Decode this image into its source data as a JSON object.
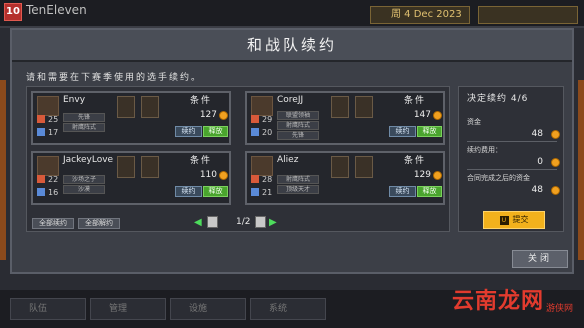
{
  "app": {
    "team_name": "TenEleven",
    "logo_text": "10",
    "date": "周 4 Dec 2023"
  },
  "dialog": {
    "title": "和战队续约",
    "instruction": "请和需要在下赛季使用的选手续约。",
    "close_label": "关闭"
  },
  "players": [
    {
      "name": "Envy",
      "stat_attack": "25",
      "stat_defense": "17",
      "traits": [
        "先锋",
        "射鹰阵式"
      ],
      "condition_label": "条件",
      "salary": "127",
      "renew_label": "续约",
      "release_label": "释放"
    },
    {
      "name": "CoreJJ",
      "stat_attack": "29",
      "stat_defense": "20",
      "traits": [
        "联盟领袖",
        "射鹰阵式",
        "先锋"
      ],
      "condition_label": "条件",
      "salary": "147",
      "renew_label": "续约",
      "release_label": "释放"
    },
    {
      "name": "JackeyLove",
      "stat_attack": "22",
      "stat_defense": "16",
      "traits": [
        "沙场之子",
        "沙漠"
      ],
      "condition_label": "条件",
      "salary": "110",
      "renew_label": "续约",
      "release_label": "释放"
    },
    {
      "name": "Aliez",
      "stat_attack": "28",
      "stat_defense": "21",
      "traits": [
        "射鹰阵式",
        "顶级天才"
      ],
      "condition_label": "条件",
      "salary": "129",
      "renew_label": "续约",
      "release_label": "释放"
    }
  ],
  "pagination": {
    "renew_all": "全部续约",
    "release_all": "全部解约",
    "page": "1/2"
  },
  "summary": {
    "heading": "决定续约 4/6",
    "funds_label": "资金",
    "funds_value": "48",
    "cost_label": "续约费用：",
    "cost_value": "0",
    "after_label": "合同完成之后的资金",
    "after_value": "48",
    "submit_key": "U",
    "submit_label": "提交"
  },
  "bottom_tabs": [
    "队伍",
    "管理",
    "设施",
    "系统"
  ],
  "watermark": {
    "main": "云南龙网",
    "sub": "游侠网"
  },
  "colors": {
    "release_green": "#4aa52e",
    "submit_gold": "#f2b11c",
    "coin": "#f0a020",
    "arrow_green": "#4ddc5c"
  }
}
